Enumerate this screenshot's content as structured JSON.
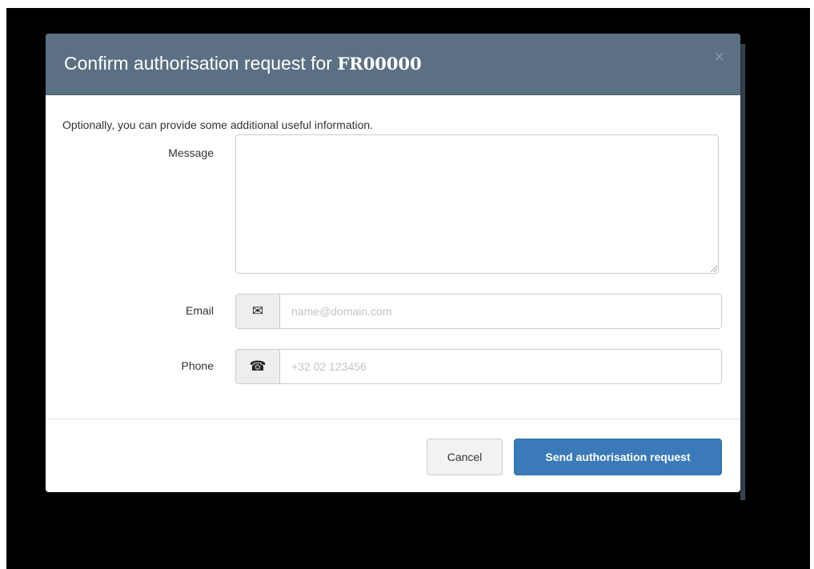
{
  "modal": {
    "title_prefix": "Confirm authorisation request for ",
    "title_code": "FR00000",
    "close_glyph": "×",
    "intro": "Optionally, you can provide some additional useful information.",
    "header_color": "#5b7082"
  },
  "form": {
    "message": {
      "label": "Message",
      "value": ""
    },
    "email": {
      "label": "Email",
      "icon": "envelope-icon",
      "icon_glyph": "✉",
      "value": "",
      "placeholder": "name@domain.com"
    },
    "phone": {
      "label": "Phone",
      "icon": "phone-icon",
      "icon_glyph": "☎",
      "value": "",
      "placeholder": "+32 02 123456"
    }
  },
  "buttons": {
    "cancel_label": "Cancel",
    "send_label": "Send authorisation request",
    "send_color": "#3a7ab9"
  }
}
